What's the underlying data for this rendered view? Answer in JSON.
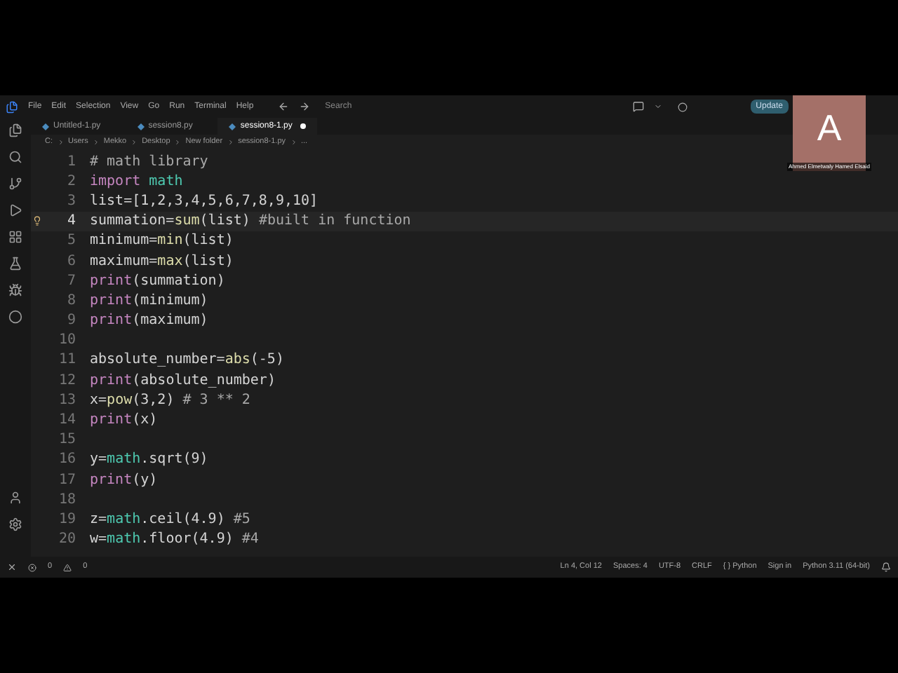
{
  "menu": [
    "File",
    "Edit",
    "Selection",
    "View",
    "Go",
    "Run",
    "Terminal",
    "Help"
  ],
  "search": {
    "placeholder": "Search"
  },
  "update_button": "Update",
  "tabs": [
    {
      "label": "Untitled-1.py",
      "selected": false,
      "modified": false
    },
    {
      "label": "session8.py",
      "selected": false,
      "modified": false
    },
    {
      "label": "session8-1.py",
      "selected": true,
      "modified": true
    }
  ],
  "breadcrumb": [
    "C:",
    "Users",
    "Mekko",
    "Desktop",
    "New folder",
    "session8-1.py",
    "..."
  ],
  "editor": {
    "lines": [
      {
        "number": "1",
        "current": false,
        "tokens": [
          {
            "text": "# math library",
            "kind": "comment"
          }
        ]
      },
      {
        "number": "2",
        "current": false,
        "tokens": [
          {
            "text": "import ",
            "kind": "keyword"
          },
          {
            "text": "math",
            "kind": "module"
          }
        ]
      },
      {
        "number": "3",
        "current": false,
        "tokens": [
          {
            "text": "list=[1,2,3,4,5,6,7,8,9,10]",
            "kind": "plain"
          }
        ]
      },
      {
        "number": "4",
        "current": true,
        "tokens": [
          {
            "text": "summation=",
            "kind": "plain"
          },
          {
            "text": "sum",
            "kind": "func"
          },
          {
            "text": "(list) ",
            "kind": "plain"
          },
          {
            "text": "#built in function",
            "kind": "comment"
          }
        ]
      },
      {
        "number": "5",
        "current": false,
        "tokens": [
          {
            "text": "minimum=",
            "kind": "plain"
          },
          {
            "text": "min",
            "kind": "func"
          },
          {
            "text": "(list)",
            "kind": "plain"
          }
        ]
      },
      {
        "number": "6",
        "current": false,
        "tokens": [
          {
            "text": "maximum=",
            "kind": "plain"
          },
          {
            "text": "max",
            "kind": "func"
          },
          {
            "text": "(list)",
            "kind": "plain"
          }
        ]
      },
      {
        "number": "7",
        "current": false,
        "tokens": [
          {
            "text": "print",
            "kind": "keyword"
          },
          {
            "text": "(summation)",
            "kind": "plain"
          }
        ]
      },
      {
        "number": "8",
        "current": false,
        "tokens": [
          {
            "text": "print",
            "kind": "keyword"
          },
          {
            "text": "(minimum)",
            "kind": "plain"
          }
        ]
      },
      {
        "number": "9",
        "current": false,
        "tokens": [
          {
            "text": "print",
            "kind": "keyword"
          },
          {
            "text": "(maximum)",
            "kind": "plain"
          }
        ]
      },
      {
        "number": "10",
        "current": false
      },
      {
        "number": "11",
        "current": false,
        "tokens": [
          {
            "text": "absolute_number=",
            "kind": "plain"
          },
          {
            "text": "abs",
            "kind": "func"
          },
          {
            "text": "(-5)",
            "kind": "plain"
          }
        ]
      },
      {
        "number": "12",
        "current": false,
        "tokens": [
          {
            "text": "print",
            "kind": "keyword"
          },
          {
            "text": "(absolute_number)",
            "kind": "plain"
          }
        ]
      },
      {
        "number": "13",
        "current": false,
        "tokens": [
          {
            "text": "x=",
            "kind": "plain"
          },
          {
            "text": "pow",
            "kind": "func"
          },
          {
            "text": "(3,2) ",
            "kind": "plain"
          },
          {
            "text": "# 3 ** 2",
            "kind": "comment"
          }
        ]
      },
      {
        "number": "14",
        "current": false,
        "tokens": [
          {
            "text": "print",
            "kind": "keyword"
          },
          {
            "text": "(x)",
            "kind": "plain"
          }
        ]
      },
      {
        "number": "15",
        "current": false
      },
      {
        "number": "16",
        "current": false,
        "tokens": [
          {
            "text": "y=",
            "kind": "plain"
          },
          {
            "text": "math",
            "kind": "module"
          },
          {
            "text": ".sqrt(9)",
            "kind": "plain"
          }
        ]
      },
      {
        "number": "17",
        "current": false,
        "tokens": [
          {
            "text": "print",
            "kind": "keyword"
          },
          {
            "text": "(y)",
            "kind": "plain"
          }
        ]
      },
      {
        "number": "18",
        "current": false
      },
      {
        "number": "19",
        "current": false,
        "tokens": [
          {
            "text": "z=",
            "kind": "plain"
          },
          {
            "text": "math",
            "kind": "module"
          },
          {
            "text": ".ceil(4.9) ",
            "kind": "plain"
          },
          {
            "text": "#5",
            "kind": "comment"
          }
        ]
      },
      {
        "number": "20",
        "current": false,
        "tokens": [
          {
            "text": "w=",
            "kind": "plain"
          },
          {
            "text": "math",
            "kind": "module"
          },
          {
            "text": ".floor(4.9) ",
            "kind": "plain"
          },
          {
            "text": "#4",
            "kind": "comment"
          }
        ]
      }
    ]
  },
  "status_bar": {
    "errors": "0",
    "warnings": "0",
    "items": [
      "Ln 4, Col 12",
      "Spaces: 4",
      "UTF-8",
      "CRLF",
      "{ } Python",
      "Sign in",
      "Python 3.11 (64-bit)"
    ]
  },
  "participant": {
    "initial": "A",
    "name": "Ahmed Elmetwaly Hamed Elsaid"
  }
}
